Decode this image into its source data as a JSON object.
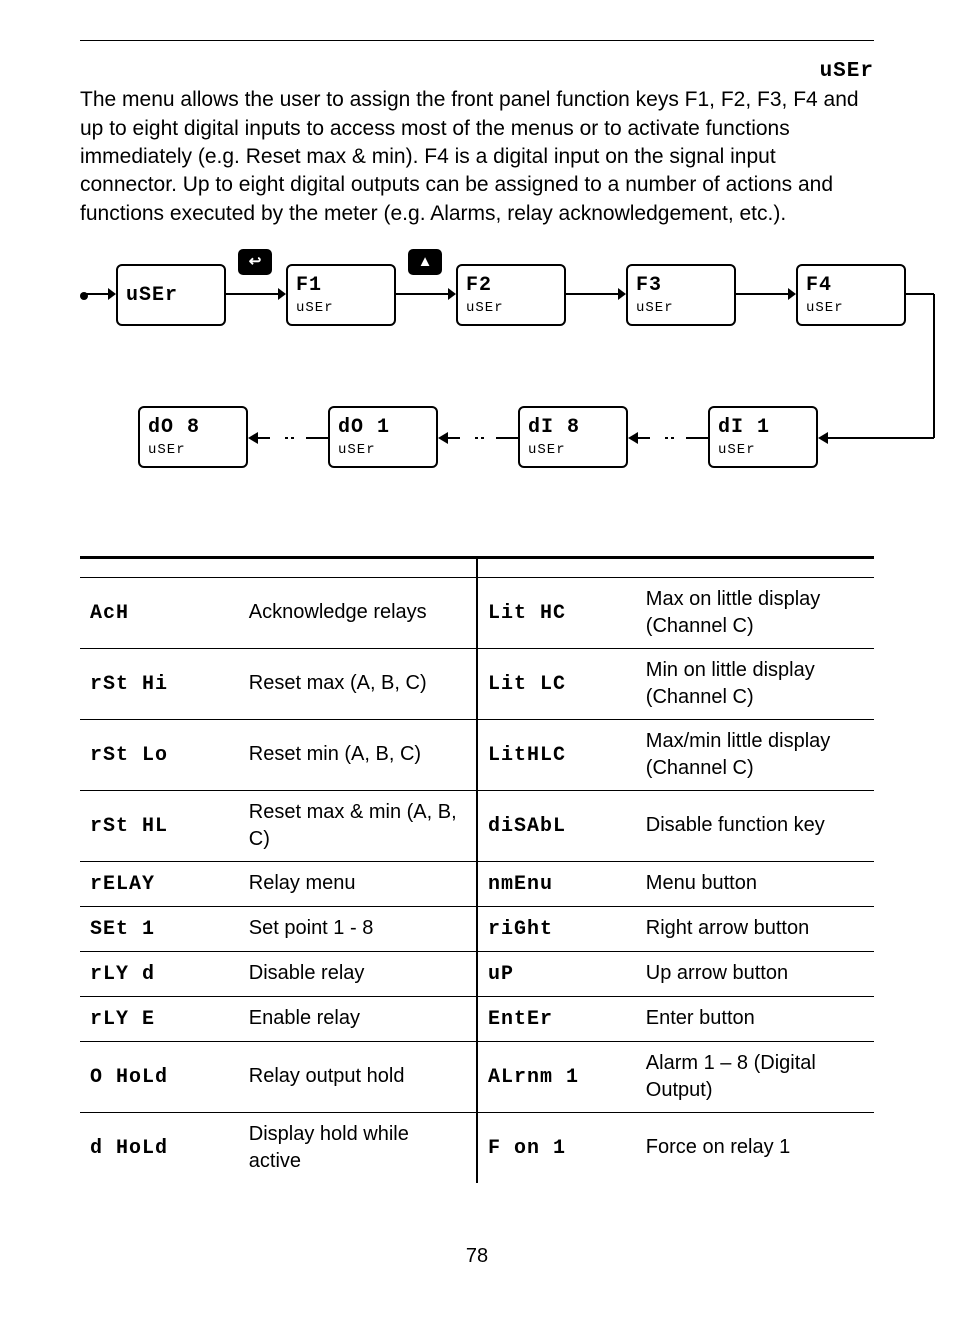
{
  "top_glyph": "uSEr",
  "intro_text": "The        menu allows the user to assign the front panel function keys F1, F2, F3, F4 and up to eight digital inputs to access most of the menus or to activate functions immediately (e.g. Reset max & min). F4 is a digital input on the signal input connector. Up to eight digital outputs can be assigned to a number of actions and functions executed by the meter (e.g. Alarms, relay acknowledgement, etc.).",
  "diagram": {
    "row1": [
      {
        "big": "uSEr",
        "sml": ""
      },
      {
        "big": "F1",
        "sml": "uSEr"
      },
      {
        "big": "F2",
        "sml": "uSEr"
      },
      {
        "big": "F3",
        "sml": "uSEr"
      },
      {
        "big": "F4",
        "sml": "uSEr"
      }
    ],
    "row2": [
      {
        "big": "dO 8",
        "sml": "uSEr"
      },
      {
        "big": "dO  1",
        "sml": "uSEr"
      },
      {
        "big": "dI 8",
        "sml": "uSEr"
      },
      {
        "big": "dI  1",
        "sml": "uSEr"
      }
    ],
    "icon1": "↩",
    "icon2": "▲",
    "dash_gap": "⸏"
  },
  "functions": [
    {
      "code": "AcH",
      "desc": "Acknowledge relays",
      "code2": "Lit HC",
      "desc2": "Max on little display (Channel C)"
    },
    {
      "code": "rSt Hi",
      "desc": "Reset max (A, B, C)",
      "code2": "Lit LC",
      "desc2": "Min on little display (Channel C)"
    },
    {
      "code": "rSt Lo",
      "desc": "Reset min (A, B, C)",
      "code2": "LitHLC",
      "desc2": "Max/min little display (Channel C)"
    },
    {
      "code": "rSt HL",
      "desc": "Reset max & min (A, B, C)",
      "code2": "diSAbL",
      "desc2": "Disable function key"
    },
    {
      "code": "rELAY",
      "desc": "Relay menu",
      "code2": "nmEnu",
      "desc2": "Menu button"
    },
    {
      "code": "SEt  1",
      "desc": "Set point 1 - 8",
      "code2": "riGht",
      "desc2": "Right arrow button"
    },
    {
      "code": "rLY d",
      "desc": "Disable relay",
      "code2": "uP",
      "desc2": "Up arrow button"
    },
    {
      "code": "rLY E",
      "desc": "Enable relay",
      "code2": "EntEr",
      "desc2": "Enter button"
    },
    {
      "code": "O HoLd",
      "desc": "Relay output hold",
      "code2": "ALrnm  1",
      "desc2": "Alarm 1 – 8 (Digital Output)"
    },
    {
      "code": "d HoLd",
      "desc": "Display hold while active",
      "code2": "F on  1",
      "desc2": "Force on relay 1"
    }
  ],
  "page_number": "78"
}
